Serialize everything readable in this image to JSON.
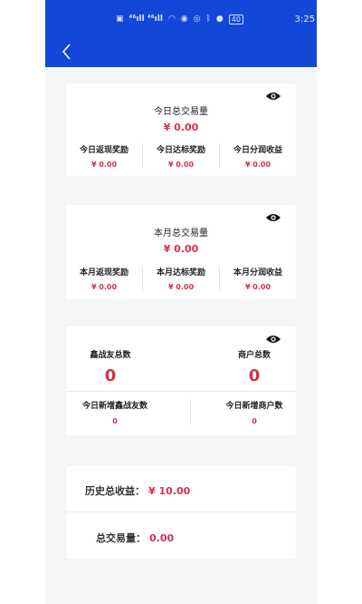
{
  "status_bar": {
    "signals": "⁴⁶ıll ⁴⁶ıll",
    "battery": "40",
    "time": "3:25"
  },
  "today": {
    "total_label": "今日总交易量",
    "total_value": "¥ 0.00",
    "items": [
      {
        "label": "今日返现奖励",
        "value": "¥ 0.00"
      },
      {
        "label": "今日达标奖励",
        "value": "¥ 0.00"
      },
      {
        "label": "今日分润收益",
        "value": "¥ 0.00"
      }
    ]
  },
  "month": {
    "total_label": "本月总交易量",
    "total_value": "¥ 0.00",
    "items": [
      {
        "label": "本月返现奖励",
        "value": "¥ 0.00"
      },
      {
        "label": "本月达标奖励",
        "value": "¥ 0.00"
      },
      {
        "label": "本月分润收益",
        "value": "¥ 0.00"
      }
    ]
  },
  "counts": {
    "partners_label": "鑫战友总数",
    "partners_value": "0",
    "merchants_label": "商户总数",
    "merchants_value": "0",
    "new_partners_label": "今日新增鑫战友数",
    "new_partners_value": "0",
    "new_merchants_label": "今日新增商户数",
    "new_merchants_value": "0"
  },
  "history": {
    "income_label": "历史总收益：",
    "income_value": "¥ 10.00",
    "volume_label": "总交易量：",
    "volume_value": "0.00"
  },
  "colors": {
    "header": "#1447d8",
    "accent_red": "#d6304c",
    "background": "#f4f5f7"
  },
  "icons": [
    "back-arrow-icon",
    "eye-icon"
  ]
}
